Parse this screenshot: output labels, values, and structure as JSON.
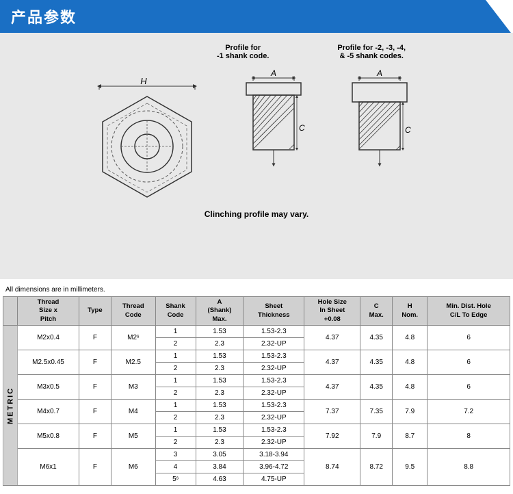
{
  "header": {
    "title": "产品参数"
  },
  "diagram": {
    "label1": "Profile for",
    "label1b": "-1 shank code.",
    "label2": "Profile for -2, -3, -4,",
    "label2b": "& -5 shank codes.",
    "clinching_note": "Clinching profile may vary.",
    "dimensions_note": "All dimensions are in millimeters."
  },
  "table": {
    "headers": [
      "Thread Size x Pitch",
      "Type",
      "Thread Code",
      "Shank Code",
      "A (Shank) Max.",
      "Sheet Thickness",
      "Hole Size In Sheet +0.08",
      "C Max.",
      "H Nom.",
      "Min. Dist. Hole C/L To Edge"
    ],
    "metric_label": "METRIC",
    "rows": [
      {
        "thread": "M2x0.4",
        "type": "F",
        "thread_code": "M2ˢ",
        "sub": [
          {
            "shank": "1",
            "a_max": "1.53",
            "sheet": "1.53-2.3",
            "hole": "4.37",
            "c_max": "4.35",
            "h_nom": "4.8",
            "edge": "6"
          },
          {
            "shank": "2",
            "a_max": "2.3",
            "sheet": "2.32-UP",
            "hole": "",
            "c_max": "",
            "h_nom": "",
            "edge": ""
          }
        ]
      },
      {
        "thread": "M2.5x0.45",
        "type": "F",
        "thread_code": "M2.5",
        "sub": [
          {
            "shank": "1",
            "a_max": "1.53",
            "sheet": "1.53-2.3",
            "hole": "4.37",
            "c_max": "4.35",
            "h_nom": "4.8",
            "edge": "6"
          },
          {
            "shank": "2",
            "a_max": "2.3",
            "sheet": "2.32-UP",
            "hole": "",
            "c_max": "",
            "h_nom": "",
            "edge": ""
          }
        ]
      },
      {
        "thread": "M3x0.5",
        "type": "F",
        "thread_code": "M3",
        "sub": [
          {
            "shank": "1",
            "a_max": "1.53",
            "sheet": "1.53-2.3",
            "hole": "4.37",
            "c_max": "4.35",
            "h_nom": "4.8",
            "edge": "6"
          },
          {
            "shank": "2",
            "a_max": "2.3",
            "sheet": "2.32-UP",
            "hole": "",
            "c_max": "",
            "h_nom": "",
            "edge": ""
          }
        ]
      },
      {
        "thread": "M4x0.7",
        "type": "F",
        "thread_code": "M4",
        "sub": [
          {
            "shank": "1",
            "a_max": "1.53",
            "sheet": "1.53-2.3",
            "hole": "7.37",
            "c_max": "7.35",
            "h_nom": "7.9",
            "edge": "7.2"
          },
          {
            "shank": "2",
            "a_max": "2.3",
            "sheet": "2.32-UP",
            "hole": "",
            "c_max": "",
            "h_nom": "",
            "edge": ""
          }
        ]
      },
      {
        "thread": "M5x0.8",
        "type": "F",
        "thread_code": "M5",
        "sub": [
          {
            "shank": "1",
            "a_max": "1.53",
            "sheet": "1.53-2.3",
            "hole": "7.92",
            "c_max": "7.9",
            "h_nom": "8.7",
            "edge": "8"
          },
          {
            "shank": "2",
            "a_max": "2.3",
            "sheet": "2.32-UP",
            "hole": "",
            "c_max": "",
            "h_nom": "",
            "edge": ""
          }
        ]
      },
      {
        "thread": "M6x1",
        "type": "F",
        "thread_code": "M6",
        "sub": [
          {
            "shank": "3",
            "a_max": "3.05",
            "sheet": "3.18-3.94",
            "hole": "8.74",
            "c_max": "8.72",
            "h_nom": "9.5",
            "edge": "8.8"
          },
          {
            "shank": "4",
            "a_max": "3.84",
            "sheet": "3.96-4.72",
            "hole": "",
            "c_max": "",
            "h_nom": "",
            "edge": ""
          },
          {
            "shank": "5ˢ",
            "a_max": "4.63",
            "sheet": "4.75-UP",
            "hole": "",
            "c_max": "",
            "h_nom": "",
            "edge": ""
          }
        ]
      }
    ]
  }
}
